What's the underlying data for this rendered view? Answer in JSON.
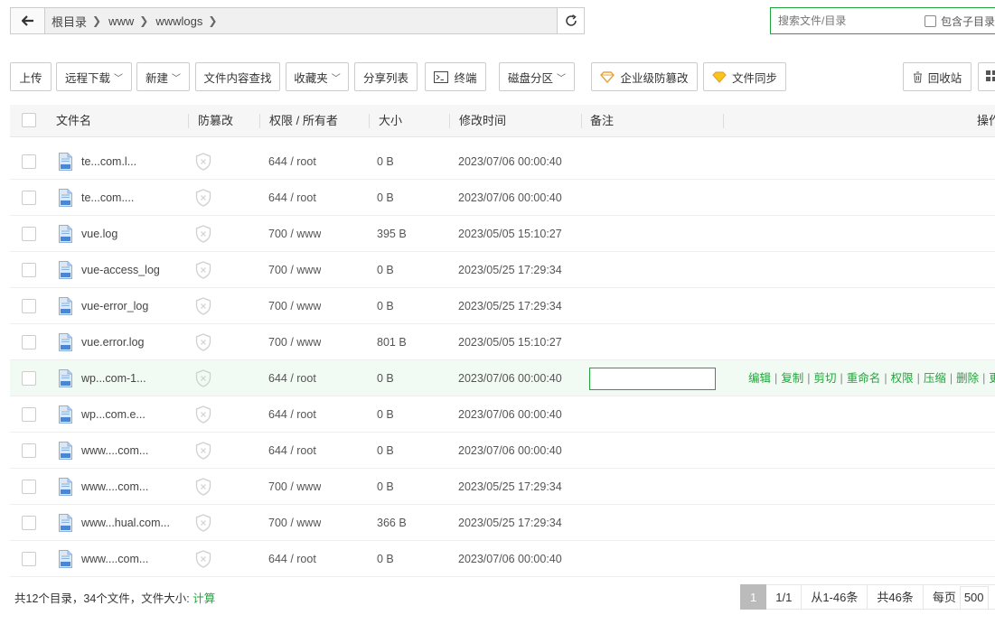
{
  "address": {
    "crumbs": [
      "根目录",
      "www",
      "wwwlogs"
    ]
  },
  "search": {
    "placeholder": "搜索文件/目录",
    "include_sub": "包含子目录"
  },
  "toolbar": {
    "upload": "上传",
    "remote_download": "远程下载",
    "new": "新建",
    "content_search": "文件内容查找",
    "favorites": "收藏夹",
    "share_list": "分享列表",
    "terminal": "终端",
    "disk_partition": "磁盘分区",
    "enterprise_tamper": "企业级防篡改",
    "file_sync": "文件同步",
    "recycle_bin": "回收站"
  },
  "table": {
    "headers": {
      "name": "文件名",
      "tamper": "防篡改",
      "perm": "权限 / 所有者",
      "size": "大小",
      "mtime": "修改时间",
      "note": "备注",
      "ops": "操作"
    },
    "rows": [
      {
        "name": "te...com.l...",
        "perm": "644 / root",
        "size": "0 B",
        "mtime": "2023/07/06 00:00:40"
      },
      {
        "name": "te...com....",
        "perm": "644 / root",
        "size": "0 B",
        "mtime": "2023/07/06 00:00:40"
      },
      {
        "name": "vue.log",
        "perm": "700 / www",
        "size": "395 B",
        "mtime": "2023/05/05 15:10:27"
      },
      {
        "name": "vue-access_log",
        "perm": "700 / www",
        "size": "0 B",
        "mtime": "2023/05/25 17:29:34"
      },
      {
        "name": "vue-error_log",
        "perm": "700 / www",
        "size": "0 B",
        "mtime": "2023/05/25 17:29:34"
      },
      {
        "name": "vue.error.log",
        "perm": "700 / www",
        "size": "801 B",
        "mtime": "2023/05/05 15:10:27"
      },
      {
        "name": "wp...com-1...",
        "perm": "644 / root",
        "size": "0 B",
        "mtime": "2023/07/06 00:00:40"
      },
      {
        "name": "wp...com.e...",
        "perm": "644 / root",
        "size": "0 B",
        "mtime": "2023/07/06 00:00:40"
      },
      {
        "name": "www....com...",
        "perm": "644 / root",
        "size": "0 B",
        "mtime": "2023/07/06 00:00:40"
      },
      {
        "name": "www....com...",
        "perm": "700 / www",
        "size": "0 B",
        "mtime": "2023/05/25 17:29:34"
      },
      {
        "name": "www...hual.com...",
        "perm": "700 / www",
        "size": "366 B",
        "mtime": "2023/05/25 17:29:34"
      },
      {
        "name": "www....com...",
        "perm": "644 / root",
        "size": "0 B",
        "mtime": "2023/07/06 00:00:40"
      }
    ],
    "ops": [
      "编辑",
      "复制",
      "剪切",
      "重命名",
      "权限",
      "压缩",
      "删除",
      "更多"
    ]
  },
  "footer": {
    "summary": "共12个目录，34个文件，文件大小: ",
    "calc": "计算",
    "page_current": "1",
    "page_total": "1/1",
    "range": "从1-46条",
    "total": "共46条",
    "per_page_label": "每页",
    "per_page": "500"
  },
  "colors": {
    "accent": "#20a53a",
    "highlight_row": "#f2faf4"
  }
}
